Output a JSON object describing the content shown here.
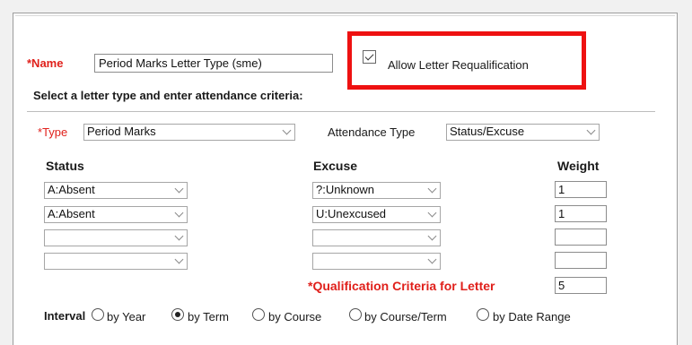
{
  "name": {
    "label": "*Name",
    "value": "Period Marks Letter Type (sme)"
  },
  "requalification": {
    "label": "Allow Letter Requalification",
    "checked": true
  },
  "instruction": "Select a letter type and enter attendance criteria:",
  "type": {
    "star": "*",
    "label": "Type",
    "value": "Period Marks"
  },
  "attendance_type": {
    "label": "Attendance Type",
    "value": "Status/Excuse"
  },
  "columns": {
    "status": "Status",
    "excuse": "Excuse",
    "weight": "Weight"
  },
  "rows": [
    {
      "status": "A:Absent",
      "excuse": "?:Unknown",
      "weight": "1"
    },
    {
      "status": "A:Absent",
      "excuse": "U:Unexcused",
      "weight": "1"
    },
    {
      "status": "",
      "excuse": "",
      "weight": ""
    },
    {
      "status": "",
      "excuse": "",
      "weight": ""
    }
  ],
  "qualification": {
    "label": "*Qualification Criteria for Letter",
    "value": "5"
  },
  "interval": {
    "label": "Interval",
    "options": [
      {
        "label": "by Year",
        "selected": false
      },
      {
        "label": "by Term",
        "selected": true
      },
      {
        "label": "by Course",
        "selected": false
      },
      {
        "label": "by Course/Term",
        "selected": false
      },
      {
        "label": "by Date Range",
        "selected": false
      }
    ]
  },
  "colors": {
    "required": "#e0201b",
    "highlight": "#ee1111"
  },
  "icons": [
    "checkbox-icon",
    "chevron-down-icon",
    "radio-icon"
  ]
}
